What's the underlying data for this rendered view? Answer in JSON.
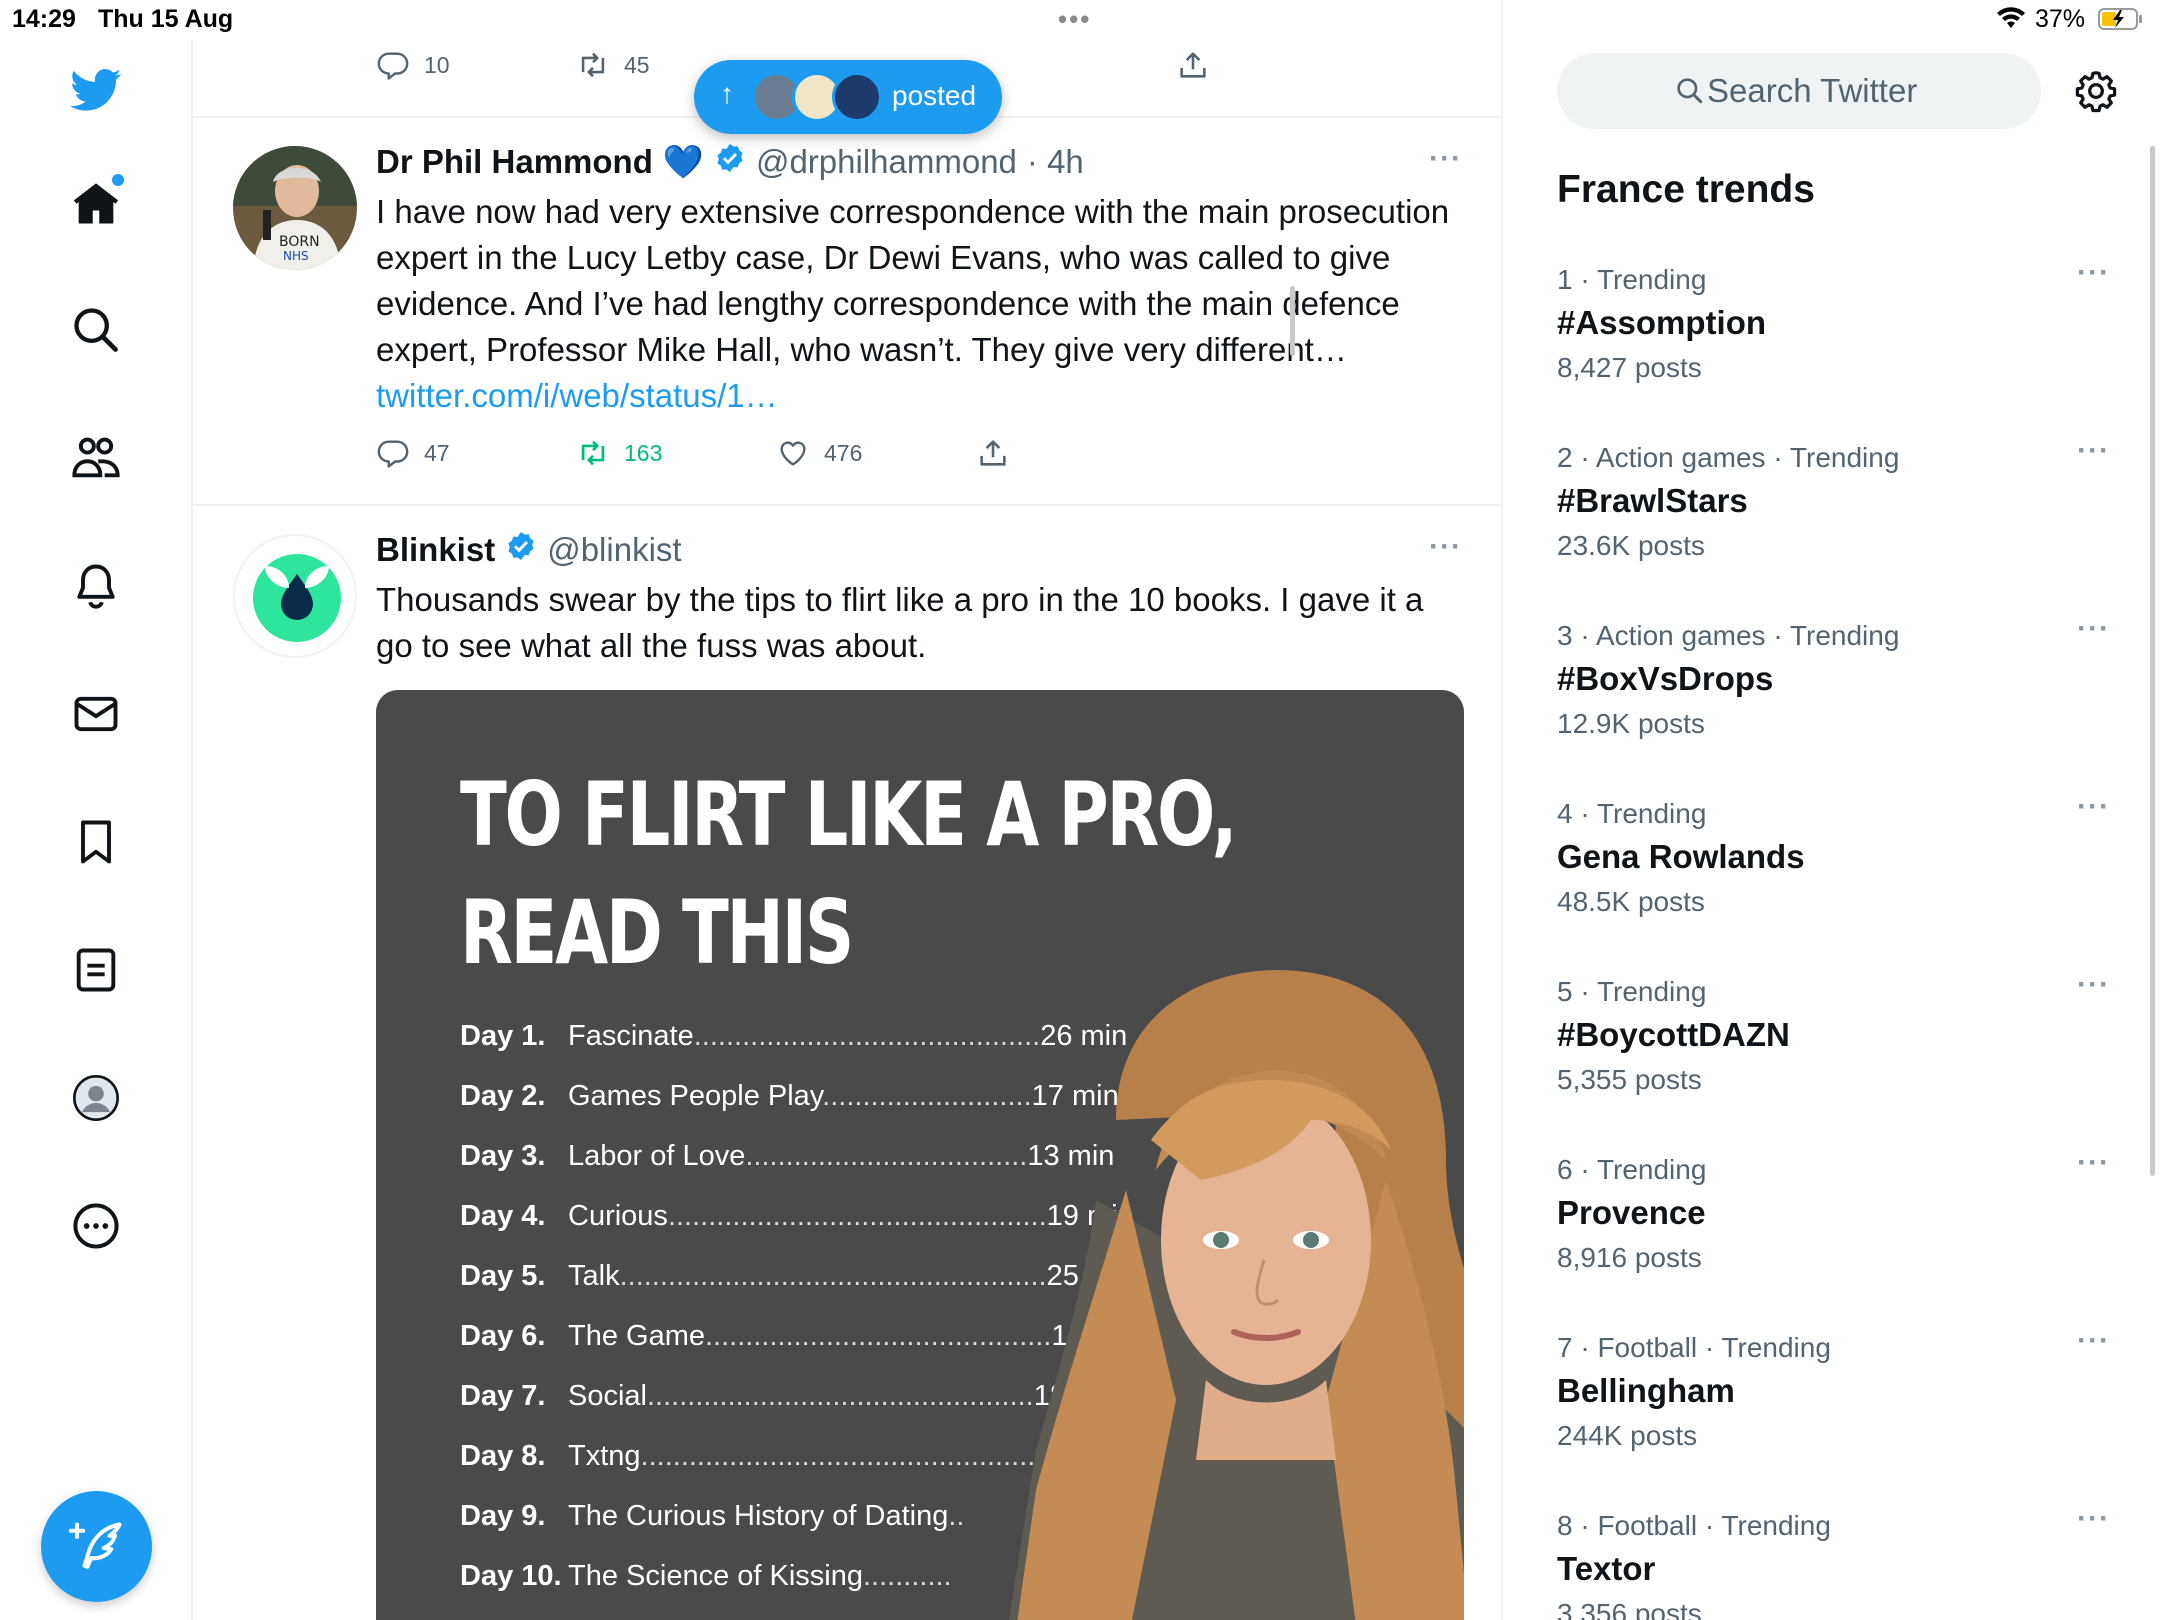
{
  "status_bar": {
    "time": "14:29",
    "date": "Thu 15 Aug",
    "battery": "37%"
  },
  "timeline": {
    "prev_actions": {
      "replies": "10",
      "reposts": "45"
    },
    "new_posts_pill": {
      "label": "posted"
    },
    "tweets": [
      {
        "name": "Dr Phil Hammond",
        "emoji": "💙",
        "handle": "@drphilhammond",
        "time": "· 4h",
        "text": "I have now had very extensive correspondence with the main prosecution expert in the Lucy Letby case, Dr Dewi Evans, who was called to give evidence. And I’ve had lengthy correspondence with the main defence expert, Professor Mike Hall, who wasn’t. They give very different… ",
        "link": "twitter.com/i/web/status/1…",
        "replies": "47",
        "reposts": "163",
        "likes": "476"
      },
      {
        "name": "Blinkist",
        "handle": "@blinkist",
        "text": "Thousands swear by the tips to flirt like a pro in the 10 books. I gave it a go to see what all the fuss was about.",
        "media": {
          "title_line1": "TO FLIRT LIKE A PRO,",
          "title_line2": "READ THIS",
          "days": [
            {
              "day": "Day 1.",
              "title": "Fascinate",
              "dots": "...........................................",
              "time": "26 min"
            },
            {
              "day": "Day 2.",
              "title": "Games People Play",
              "dots": "..........................",
              "time": "17 min"
            },
            {
              "day": "Day 3.",
              "title": "Labor of Love",
              "dots": "...................................",
              "time": "13 min"
            },
            {
              "day": "Day 4.",
              "title": "Curious",
              "dots": "...............................................",
              "time": "19 min"
            },
            {
              "day": "Day 5.",
              "title": "Talk",
              "dots": ".....................................................",
              "time": "25 min"
            },
            {
              "day": "Day 6.",
              "title": "The Game",
              "dots": "...........................................",
              "time": "16 min"
            },
            {
              "day": "Day 7.",
              "title": "Social",
              "dots": "................................................",
              "time": "18 min"
            },
            {
              "day": "Day 8.",
              "title": "Txtng",
              "dots": "...................................................",
              "time": ""
            },
            {
              "day": "Day 9.",
              "title": "The Curious History of Dating",
              "dots": "..",
              "time": ""
            },
            {
              "day": "Day 10.",
              "title": "The Science of Kissing",
              "dots": "...........",
              "time": ""
            }
          ]
        }
      }
    ]
  },
  "right_panel": {
    "search_placeholder": "Search Twitter",
    "trends_title": "France trends",
    "trends": [
      {
        "meta": "1 · Trending",
        "name": "#Assomption",
        "posts": "8,427 posts"
      },
      {
        "meta": "2 · Action games · Trending",
        "name": "#BrawlStars",
        "posts": "23.6K posts"
      },
      {
        "meta": "3 · Action games · Trending",
        "name": "#BoxVsDrops",
        "posts": "12.9K posts"
      },
      {
        "meta": "4 · Trending",
        "name": "Gena Rowlands",
        "posts": "48.5K posts"
      },
      {
        "meta": "5 · Trending",
        "name": "#BoycottDAZN",
        "posts": "5,355 posts"
      },
      {
        "meta": "6 · Trending",
        "name": "Provence",
        "posts": "8,916 posts"
      },
      {
        "meta": "7 · Football · Trending",
        "name": "Bellingham",
        "posts": "244K posts"
      },
      {
        "meta": "8 · Football · Trending",
        "name": "Textor",
        "posts": "3,356 posts"
      }
    ]
  },
  "icons": [
    "twitter-logo-icon",
    "home-icon",
    "search-icon",
    "communities-icon",
    "notifications-icon",
    "messages-icon",
    "bookmarks-icon",
    "lists-icon",
    "profile-icon",
    "more-icon",
    "compose-icon",
    "reply-icon",
    "retweet-icon",
    "like-icon",
    "share-icon",
    "verified-icon",
    "gear-icon"
  ],
  "colors": {
    "accent": "#1d9bf0",
    "retweet_active": "#00ba7c",
    "text_secondary": "#536471"
  }
}
